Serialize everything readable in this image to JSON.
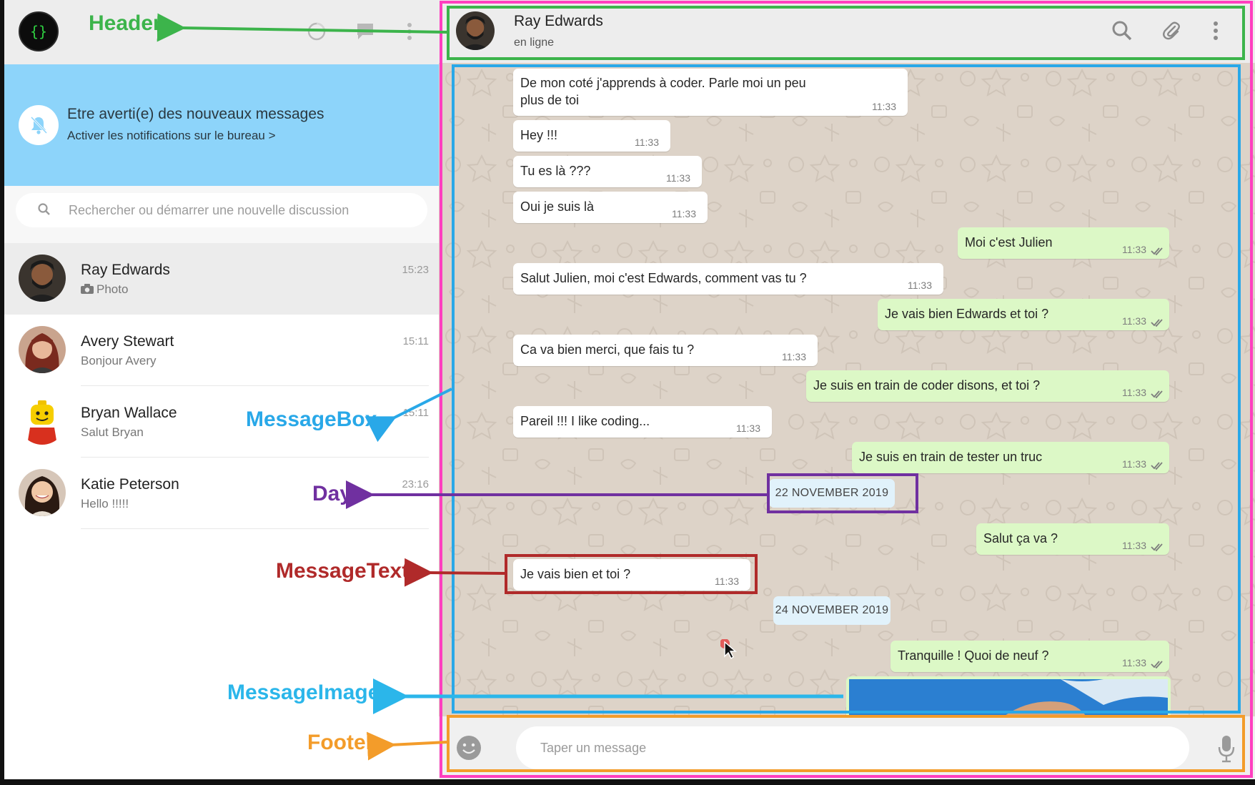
{
  "left_header": {
    "user_avatar_text": "{}",
    "icons": [
      "status-icon",
      "new-chat-icon",
      "menu-icon"
    ]
  },
  "notification": {
    "title": "Etre averti(e) des nouveaux messages",
    "subtitle": "Activer les notifications sur le bureau >"
  },
  "search": {
    "placeholder": "Rechercher ou démarrer une nouvelle discussion"
  },
  "chats": [
    {
      "name": "Ray Edwards",
      "preview": "Photo",
      "time": "15:23",
      "active": true
    },
    {
      "name": "Avery Stewart",
      "preview": "Bonjour Avery",
      "time": "15:11",
      "active": false
    },
    {
      "name": "Bryan Wallace",
      "preview": "Salut Bryan",
      "time": "15:11",
      "active": false
    },
    {
      "name": "Katie Peterson",
      "preview": "Hello !!!!!",
      "time": "23:16",
      "active": false
    }
  ],
  "chat_header": {
    "name": "Ray Edwards",
    "status": "en ligne",
    "icons": [
      "search-icon",
      "attach-icon",
      "menu-icon"
    ]
  },
  "messages": [
    {
      "dir": "in",
      "text": "De mon coté j'apprends à coder. Parle moi un peu",
      "text2": "plus de toi",
      "time": "11:33"
    },
    {
      "dir": "in",
      "text": "Hey !!!",
      "time": "11:33"
    },
    {
      "dir": "in",
      "text": "Tu es là ???",
      "time": "11:33"
    },
    {
      "dir": "in",
      "text": "Oui je suis là",
      "time": "11:33"
    },
    {
      "dir": "out",
      "text": "Moi c'est Julien",
      "time": "11:33"
    },
    {
      "dir": "in",
      "text": "Salut Julien, moi c'est Edwards, comment vas tu ?",
      "time": "11:33"
    },
    {
      "dir": "out",
      "text": "Je vais bien Edwards et toi ?",
      "time": "11:33"
    },
    {
      "dir": "in",
      "text": "Ca va bien merci, que fais tu ?",
      "time": "11:33"
    },
    {
      "dir": "out",
      "text": "Je suis en train de coder disons, et toi ?",
      "time": "11:33"
    },
    {
      "dir": "in",
      "text": "Pareil !!! I like coding...",
      "time": "11:33"
    },
    {
      "dir": "out",
      "text": "Je suis en train de tester un truc",
      "time": "11:33"
    },
    {
      "dir": "out",
      "text": "Salut ça va ?",
      "time": "11:33"
    },
    {
      "dir": "in",
      "text": "Je vais bien et toi ?",
      "time": "11:33"
    },
    {
      "dir": "out",
      "text": "Tranquille ! Quoi de neuf ?",
      "time": "11:33"
    }
  ],
  "days": [
    "22 NOVEMBER 2019",
    "24 NOVEMBER 2019"
  ],
  "footer": {
    "placeholder": "Taper un message",
    "icons": [
      "emoji-icon",
      "mic-icon"
    ]
  },
  "annotations": {
    "header": "Header",
    "message_box": "MessageBox",
    "day": "Day",
    "message_text": "MessageText",
    "message_image": "MessageImage",
    "footer": "Footer"
  },
  "colors": {
    "header_annotation": "#3cb44b",
    "message_box_annotation": "#29a8e8",
    "day_annotation": "#7030a0",
    "message_text_annotation": "#b02a2a",
    "message_image_annotation": "#2bb6ea",
    "footer_annotation": "#f39c2a",
    "frame_annotation": "#ff3fbf",
    "notification_bg": "#8dd4fa",
    "outgoing_bubble": "#dcf8c6",
    "incoming_bubble": "#ffffff"
  }
}
